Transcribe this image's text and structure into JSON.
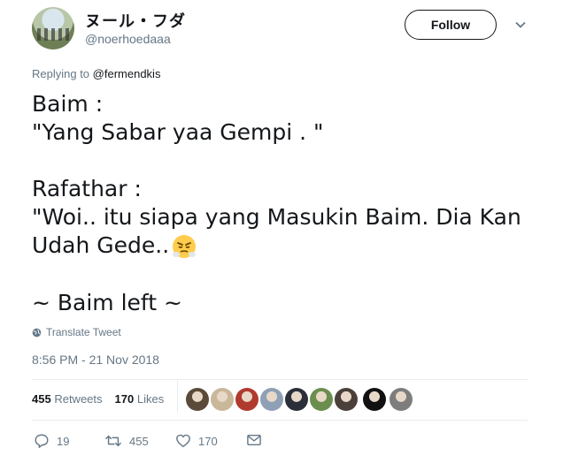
{
  "header": {
    "display_name": "ヌール・フダ",
    "handle": "@noerhoedaaa",
    "follow_label": "Follow"
  },
  "reply": {
    "prefix": "Replying to",
    "to": "@fermendkis"
  },
  "tweet": {
    "lines": [
      "Baim :",
      "\"Yang Sabar yaa Gempi . \"",
      "Rafathar :",
      "\"Woi.. itu siapa yang Masukin Baim. Dia Kan",
      "Udah Gede..",
      "~ Baim left ~"
    ]
  },
  "translate_label": "Translate Tweet",
  "timestamp": "8:56 PM - 21 Nov 2018",
  "stats": {
    "retweets_count": "455",
    "retweets_label": "Retweets",
    "likes_count": "170",
    "likes_label": "Likes"
  },
  "actions": {
    "reply_count": "19",
    "retweet_count": "455",
    "like_count": "170"
  },
  "likers": [
    {
      "color": "#5a4a3a"
    },
    {
      "color": "#c9b79a"
    },
    {
      "color": "#b03a2e"
    },
    {
      "color": "#8ea0b5"
    },
    {
      "color": "#2a2f3a"
    },
    {
      "color": "#6b8e4e"
    },
    {
      "color": "#4a3f3a"
    },
    {
      "color": "#111111"
    },
    {
      "color": "#7d7d7d"
    }
  ]
}
